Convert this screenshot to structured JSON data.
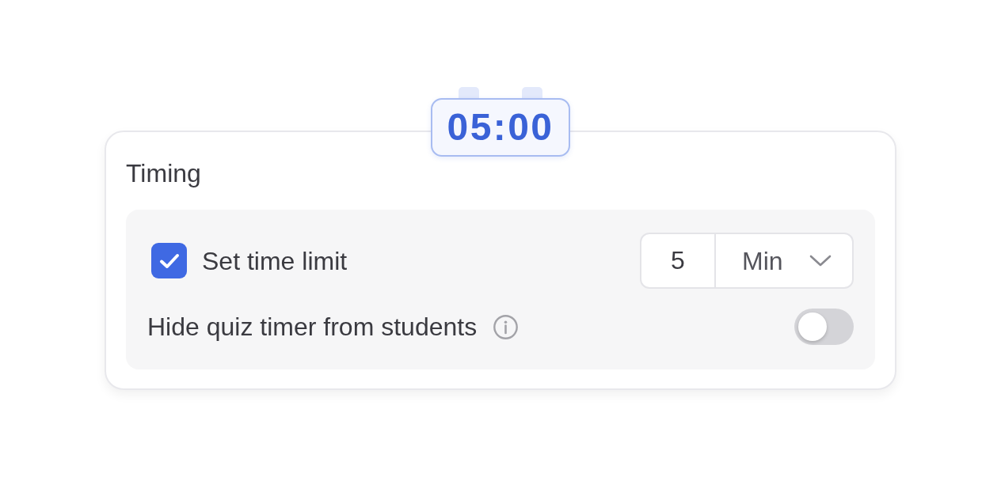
{
  "timer": {
    "display": "05:00"
  },
  "card": {
    "title": "Timing"
  },
  "time_limit": {
    "label": "Set time limit",
    "checked": true,
    "amount": "5",
    "unit": "Min"
  },
  "hide_timer": {
    "label": "Hide quiz timer from students",
    "on": false
  }
}
